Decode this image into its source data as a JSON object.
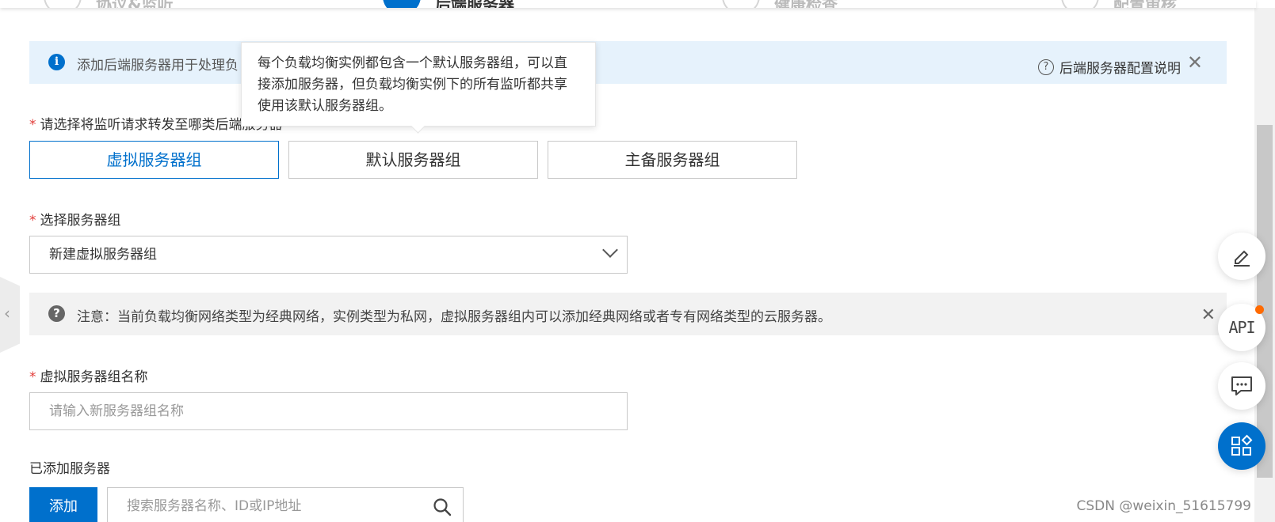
{
  "steps": [
    {
      "label": "协议&监听",
      "active": false
    },
    {
      "label": "后端服务器",
      "active": true
    },
    {
      "label": "健康检查",
      "active": false
    },
    {
      "label": "配置审核",
      "active": false
    }
  ],
  "info_banner": {
    "text": "添加后端服务器用于处理负",
    "help_link": "后端服务器配置说明",
    "close": "✕"
  },
  "tooltip": {
    "text": "每个负载均衡实例都包含一个默认服务器组，可以直接添加服务器，但负载均衡实例下的所有监听都共享使用该默认服务器组。"
  },
  "forward_type": {
    "required": "*",
    "label": "请选择将监听请求转发至哪类后端服务器",
    "options": [
      "虚拟服务器组",
      "默认服务器组",
      "主备服务器组"
    ],
    "selected": "虚拟服务器组"
  },
  "server_group_select": {
    "required": "*",
    "label": "选择服务器组",
    "value": "新建虚拟服务器组"
  },
  "notice": {
    "text": "注意：当前负载均衡网络类型为经典网络，实例类型为私网，虚拟服务器组内可以添加经典网络或者专有网络类型的云服务器。",
    "close": "✕"
  },
  "group_name": {
    "required": "*",
    "label": "虚拟服务器组名称",
    "placeholder": "请输入新服务器组名称"
  },
  "added_servers": {
    "label": "已添加服务器",
    "add_button": "添加",
    "search_placeholder": "搜索服务器名称、ID或IP地址"
  },
  "fabs": {
    "api_label": "API"
  },
  "watermark": "CSDN @weixin_51615799",
  "colors": {
    "primary": "#0070cc",
    "info_bg": "#e6f2fc",
    "notice_bg": "#f2f2f2",
    "required": "#e23c39",
    "badge": "#ff6a00"
  }
}
